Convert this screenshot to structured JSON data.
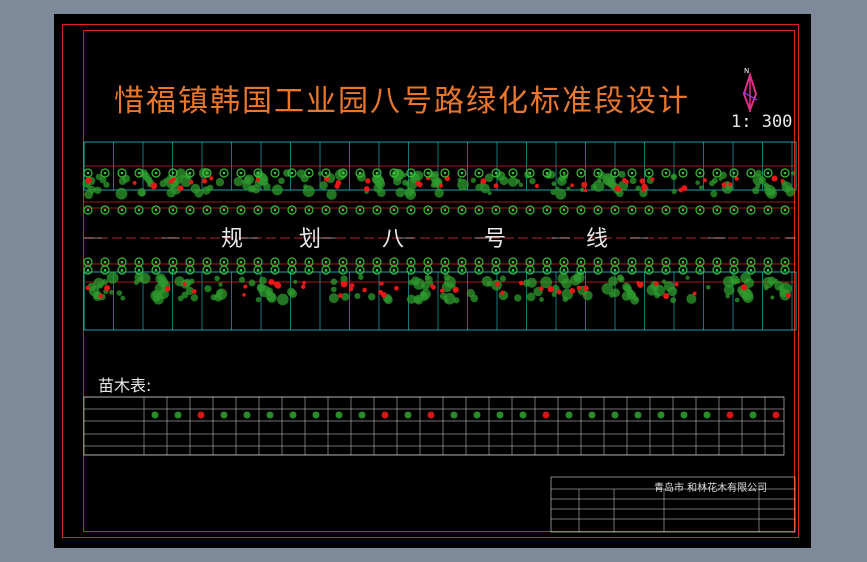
{
  "drawing": {
    "title": "惜福镇韩国工业园八号路绿化标准段设计",
    "scale": "1: 300",
    "north_label": "N",
    "road_label_chars": [
      "规",
      "划",
      "八",
      "号",
      "线"
    ],
    "table_title": "苗木表:",
    "company": "青岛市 和林花木有限公司"
  },
  "colors": {
    "background": "#000000",
    "frame": "#dd2222",
    "title": "#e8772e",
    "grid": "#22c8d8",
    "plants": "#2e9a2e",
    "flowers": "#e81818"
  }
}
